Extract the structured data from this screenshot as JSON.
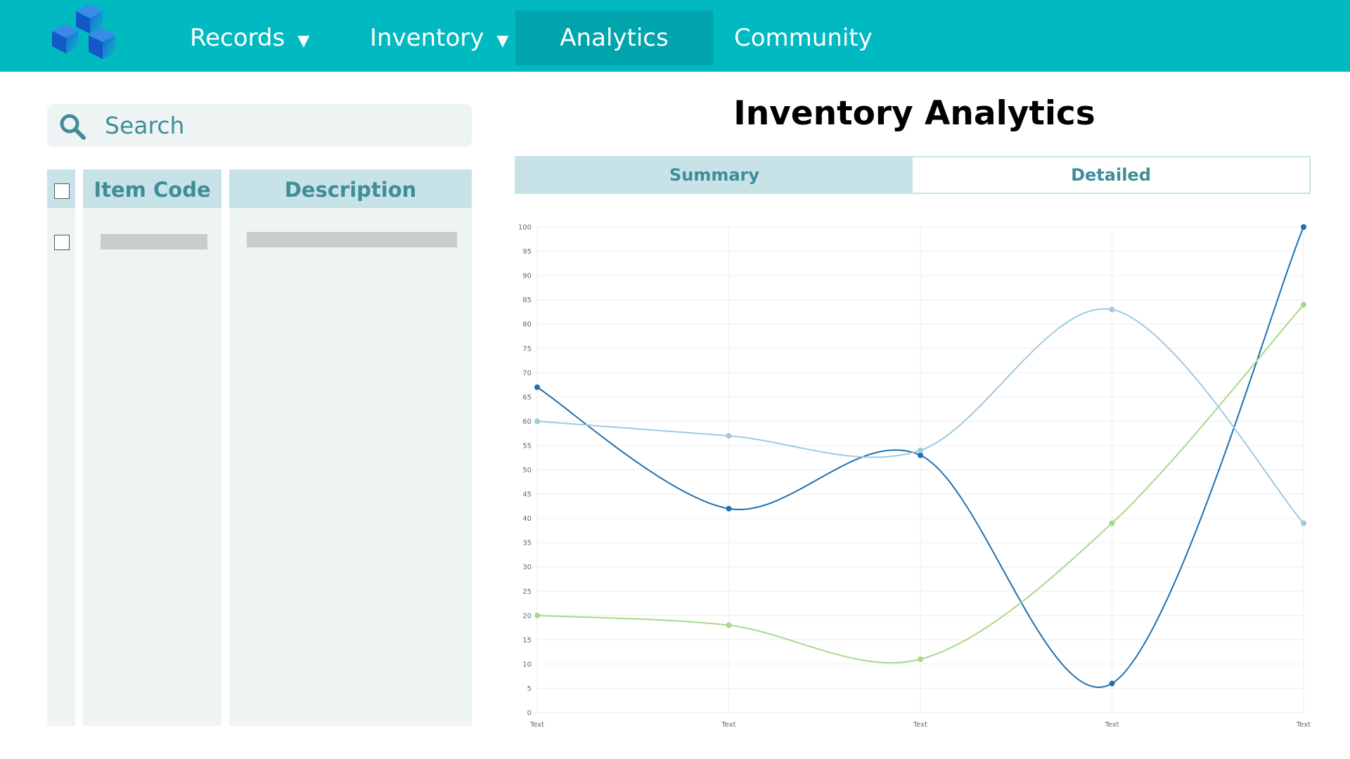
{
  "nav": {
    "items": [
      {
        "label": "Records",
        "has_caret": true
      },
      {
        "label": "Inventory",
        "has_caret": true
      },
      {
        "label": "Analytics",
        "active": true
      },
      {
        "label": "Community"
      }
    ],
    "caret": "▼"
  },
  "search": {
    "placeholder": "Search"
  },
  "table": {
    "columns": [
      "Item Code",
      "Description"
    ],
    "rows": [
      {
        "item_code": "",
        "description": ""
      }
    ]
  },
  "page": {
    "title": "Inventory Analytics"
  },
  "tabs": [
    {
      "label": "Summary",
      "active": true
    },
    {
      "label": "Detailed",
      "active": false
    }
  ],
  "colors": {
    "header": "#00b9c1",
    "accent": "#3e8d99",
    "tab_active": "#c7e3e7"
  },
  "chart_data": {
    "type": "line",
    "categories": [
      "Text",
      "Text",
      "Text",
      "Text",
      "Text"
    ],
    "ylim": [
      0,
      100
    ],
    "yticks": [
      0,
      5,
      10,
      15,
      20,
      25,
      30,
      35,
      40,
      45,
      50,
      55,
      60,
      65,
      70,
      75,
      80,
      85,
      90,
      95,
      100
    ],
    "grid": true,
    "smooth": true,
    "series": [
      {
        "color": "#1f6fad",
        "values": [
          67,
          42,
          53,
          6,
          100
        ]
      },
      {
        "color": "#9ecae1",
        "values": [
          60,
          57,
          54,
          83,
          39
        ]
      },
      {
        "color": "#a6d98a",
        "values": [
          20,
          18,
          11,
          39,
          84
        ]
      }
    ]
  }
}
